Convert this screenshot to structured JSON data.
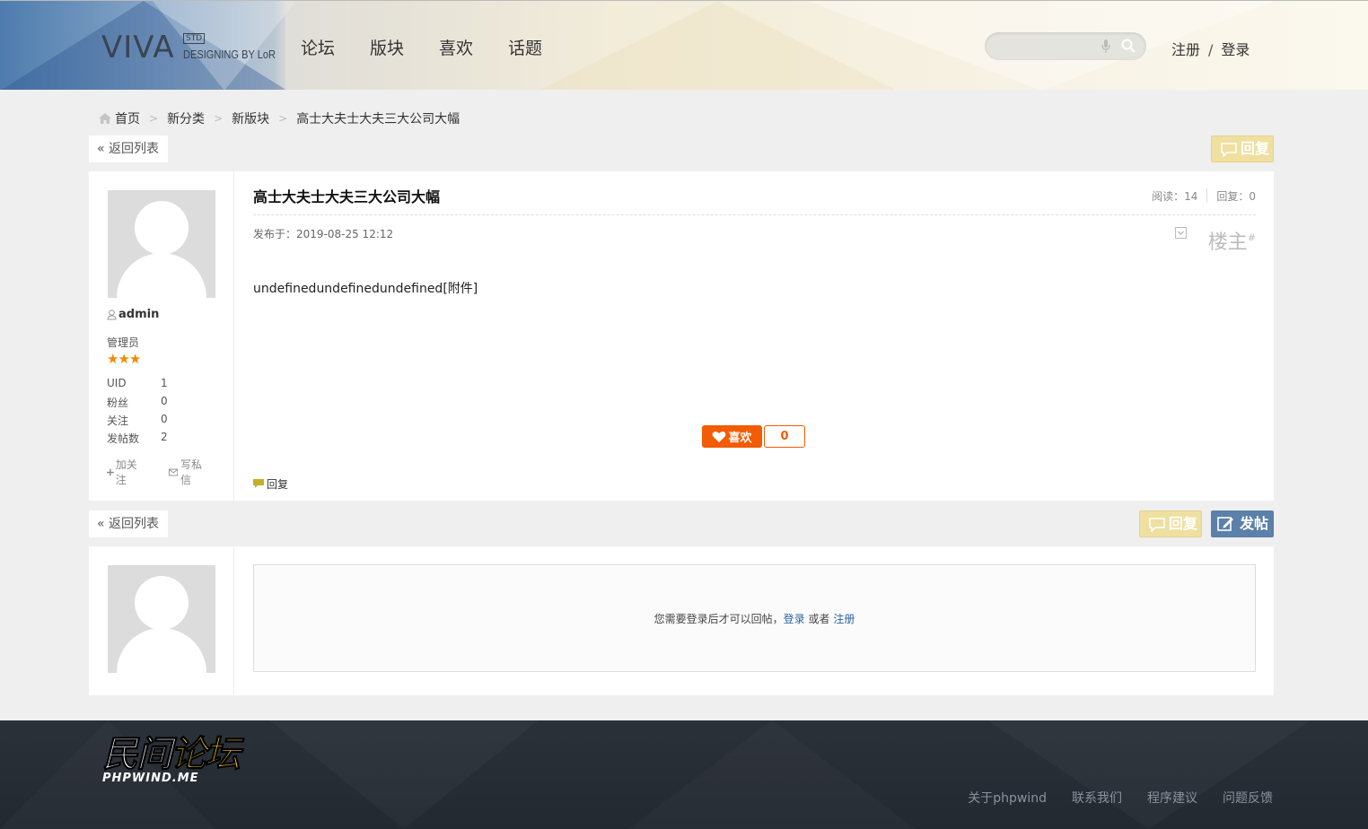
{
  "header": {
    "logo_main": "VIVA",
    "logo_badge": "STD",
    "logo_sub": "DESIGNING BY LoR",
    "nav": [
      "论坛",
      "版块",
      "喜欢",
      "话题"
    ],
    "search_placeholder": "",
    "register": "注册",
    "separator": "/",
    "login": "登录"
  },
  "breadcrumb": [
    "首页",
    "新分类",
    "新版块",
    "高士大夫士大夫三大公司大幅"
  ],
  "actions": {
    "back_to_list": "« 返回列表",
    "reply": "回复",
    "new_post": "发帖"
  },
  "post": {
    "title": "高士大夫士大夫三大公司大幅",
    "reads_label": "阅读：14",
    "replies_label": "回复：0",
    "posted_at": "发布于：2019-08-25 12:12",
    "floor": "楼主",
    "floor_mark": "#",
    "body": "undefinedundefinedundefined[附件]",
    "like_label": "喜欢",
    "like_count": "0",
    "reply_link": "回复"
  },
  "author": {
    "name": "admin",
    "role": "管理员",
    "stars": "★★★",
    "stats": [
      {
        "k": "UID",
        "v": "1"
      },
      {
        "k": "粉丝",
        "v": "0"
      },
      {
        "k": "关注",
        "v": "0"
      },
      {
        "k": "发帖数",
        "v": "2"
      }
    ],
    "follow": "加关注",
    "message": "写私信"
  },
  "reply_box": {
    "prefix": "您需要登录后才可以回帖，",
    "login": "登录",
    "or": " 或者 ",
    "register": "注册"
  },
  "footer": {
    "logo_cn_a": "民间",
    "logo_cn_b": "论坛",
    "logo_en": "PHPWIND.ME",
    "links": [
      "关于phpwind",
      "联系我们",
      "程序建议",
      "问题反馈"
    ]
  },
  "colors": {
    "like": "#f25c05",
    "reply_btn": "#efe0a0",
    "post_btn": "#5b80a9",
    "link": "#2b63a0",
    "star": "#f08a00"
  }
}
